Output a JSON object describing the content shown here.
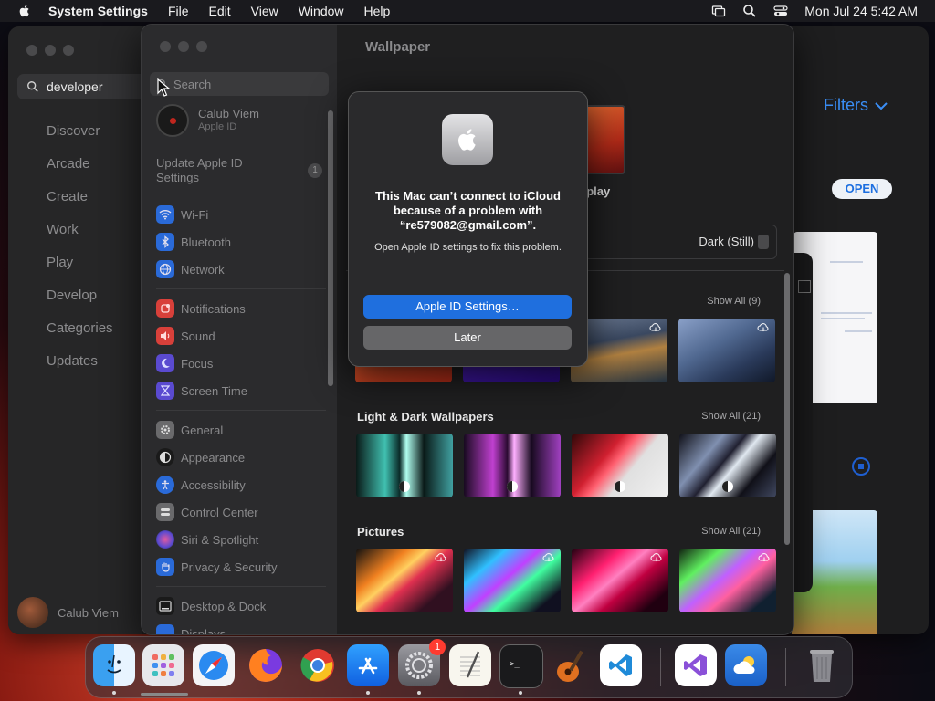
{
  "menubar": {
    "app": "System Settings",
    "items": [
      "File",
      "Edit",
      "View",
      "Window",
      "Help"
    ],
    "clock": "Mon Jul 24  5:42 AM"
  },
  "appstore": {
    "search_value": "developer",
    "nav": [
      "Discover",
      "Arcade",
      "Create",
      "Work",
      "Play",
      "Develop",
      "Categories",
      "Updates"
    ],
    "user": "Calub Viem",
    "filters": "Filters",
    "open_label": "OPEN"
  },
  "settings": {
    "search_placeholder": "Search",
    "profile": {
      "name": "Calub Viem",
      "sub": "Apple ID"
    },
    "update": {
      "label": "Update Apple ID Settings",
      "badge": "1"
    },
    "items": {
      "wifi": "Wi-Fi",
      "bluetooth": "Bluetooth",
      "network": "Network",
      "notifications": "Notifications",
      "sound": "Sound",
      "focus": "Focus",
      "screentime": "Screen Time",
      "general": "General",
      "appearance": "Appearance",
      "accessibility": "Accessibility",
      "controlcenter": "Control Center",
      "siri": "Siri & Spotlight",
      "privacy": "Privacy & Security",
      "desktop": "Desktop & Dock",
      "displays": "Displays"
    },
    "main": {
      "title": "Wallpaper",
      "display_label": "splay",
      "appearance_value": "Dark (Still)",
      "sections": [
        {
          "title": "",
          "show_all": "Show All (9)"
        },
        {
          "title": "Light & Dark Wallpapers",
          "show_all": "Show All (21)"
        },
        {
          "title": "Pictures",
          "show_all": "Show All (21)"
        }
      ]
    }
  },
  "alert": {
    "message": "This Mac can’t connect to iCloud because of a problem with “re579082@gmail.com”.",
    "info": "Open Apple ID settings to fix this problem.",
    "primary": "Apple ID Settings…",
    "secondary": "Later"
  },
  "dock": {
    "apps": [
      "Finder",
      "Launchpad",
      "Safari",
      "Firefox",
      "Chrome",
      "App Store",
      "System Settings",
      "TextEdit",
      "Terminal",
      "GarageBand",
      "Visual Studio Code",
      "Visual Studio",
      "Weather",
      "Trash"
    ],
    "settings_badge": "1"
  }
}
